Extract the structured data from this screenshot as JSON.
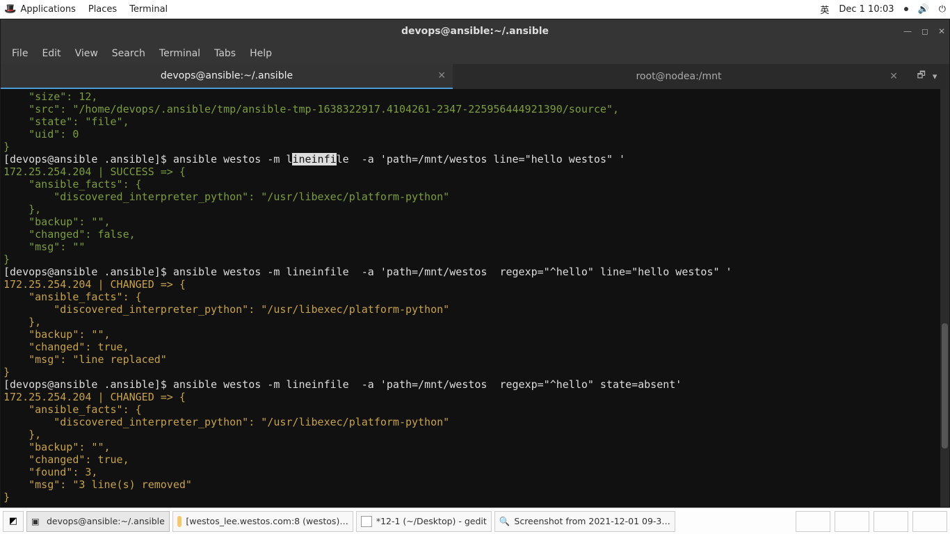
{
  "top_panel": {
    "applications": "Applications",
    "places": "Places",
    "terminal": "Terminal",
    "input": "英",
    "clock": "Dec 1  10:03"
  },
  "window": {
    "title": "devops@ansible:~/.ansible"
  },
  "menubar": {
    "file": "File",
    "edit": "Edit",
    "view": "View",
    "search": "Search",
    "terminal": "Terminal",
    "tabs": "Tabs",
    "help": "Help"
  },
  "tabs": {
    "t0": "devops@ansible:~/.ansible",
    "t1": "root@nodea:/mnt"
  },
  "term": {
    "l00": "    \"size\": 12,",
    "l01": "    \"src\": \"/home/devops/.ansible/tmp/ansible-tmp-1638322917.4104261-2347-225956444921390/source\",",
    "l02": "    \"state\": \"file\",",
    "l03": "    \"uid\": 0",
    "l04": "}",
    "p1_a": "[devops@ansible .ansible]$ ",
    "p1_b": "ansible westos -m l",
    "p1_hl": "ineinfi",
    "p1_c": "le  -a 'path=/mnt/westos line=\"hello westos\" '",
    "l06": "172.25.254.204 | SUCCESS => {",
    "l07": "    \"ansible_facts\": {",
    "l08": "        \"discovered_interpreter_python\": \"/usr/libexec/platform-python\"",
    "l09": "    },",
    "l10": "    \"backup\": \"\",",
    "l11": "    \"changed\": false,",
    "l12": "    \"msg\": \"\"",
    "l13": "}",
    "p2_a": "[devops@ansible .ansible]$ ",
    "p2_b": "ansible westos -m lineinfile  -a 'path=/mnt/westos  regexp=\"^hello\" line=\"hello westos\" '",
    "l15": "172.25.254.204 | CHANGED => {",
    "l16": "    \"ansible_facts\": {",
    "l17": "        \"discovered_interpreter_python\": \"/usr/libexec/platform-python\"",
    "l18": "    },",
    "l19": "    \"backup\": \"\",",
    "l20": "    \"changed\": true,",
    "l21": "    \"msg\": \"line replaced\"",
    "l22": "}",
    "p3_a": "[devops@ansible .ansible]$ ",
    "p3_b": "ansible westos -m lineinfile  -a 'path=/mnt/westos  regexp=\"^hello\" state=absent'",
    "l24": "172.25.254.204 | CHANGED => {",
    "l25": "    \"ansible_facts\": {",
    "l26": "        \"discovered_interpreter_python\": \"/usr/libexec/platform-python\"",
    "l27": "    },",
    "l28": "    \"backup\": \"\",",
    "l29": "    \"changed\": true,",
    "l30": "    \"found\": 3,",
    "l31": "    \"msg\": \"3 line(s) removed\"",
    "l32": "}"
  },
  "taskbar": {
    "t0": "devops@ansible:~/.ansible",
    "t1": "[westos_lee.westos.com:8 (westos)…",
    "t2": "*12-1 (~/Desktop) - gedit",
    "t3": "Screenshot from 2021-12-01 09-3…"
  }
}
